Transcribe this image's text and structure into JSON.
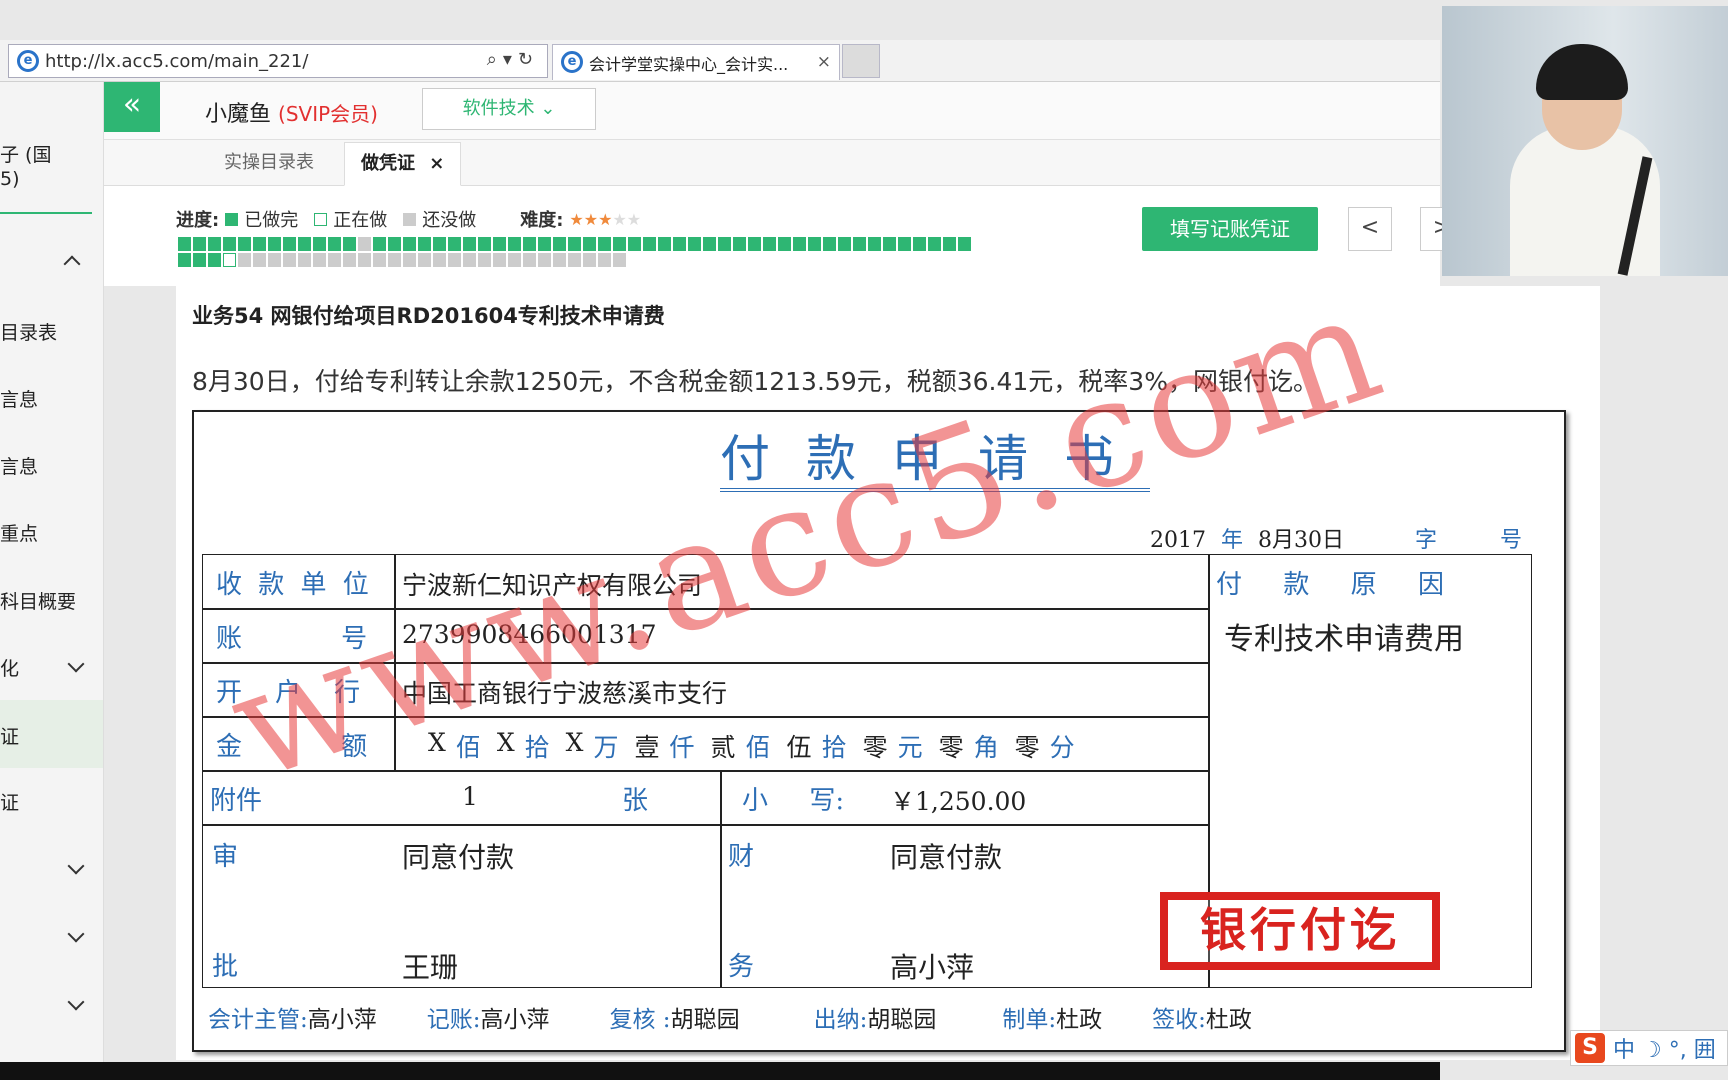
{
  "browser": {
    "url": "http://lx.acc5.com/main_221/",
    "tab_title": "会计学堂实操中心_会计实...",
    "tab_close": "×"
  },
  "sidebar": {
    "top_label_1": "子 (国",
    "top_label_2": "5)",
    "items": [
      "目录表",
      "言息",
      "言息",
      "重点",
      "科目概要",
      "化",
      "证",
      "证"
    ]
  },
  "header": {
    "collapse_icon": "«",
    "username": "小魔鱼",
    "vip_badge": "(SVIP会员)",
    "soft_button": "软件技术 ⌄"
  },
  "tabs": [
    {
      "label": "实操目录表"
    },
    {
      "label": "做凭证",
      "close": "×"
    }
  ],
  "progress": {
    "label": "进度:",
    "done": "已做完",
    "doing": "正在做",
    "todo": "还没做",
    "difficulty_label": "难度:",
    "difficulty_stars": 3,
    "difficulty_max": 5,
    "row1_done": 53,
    "row2": {
      "done": 3,
      "doing_index": 3,
      "total": 30
    }
  },
  "actions": {
    "fill_voucher": "填写记账凭证",
    "prev": "<",
    "next": ">"
  },
  "business": {
    "title": "业务54 网银付给项目RD201604专利技术申请费",
    "description": "8月30日，付给专利转让余款1250元，不含税金额1213.59元，税额36.41元，税率3%，网银付讫。"
  },
  "form": {
    "title": "付款申请书",
    "date_year": "2017",
    "date_year_unit": "年",
    "date_md": "8月30日",
    "zi": "字",
    "hao": "号",
    "payee_label": "收 款 单 位",
    "payee": "宁波新仁知识产权有限公司",
    "account_label": "账            号",
    "account": "2739908466001317",
    "bank_label": "开    户    行",
    "bank": "中国工商银行宁波慈溪市支行",
    "amount_label": "金            额",
    "amount_capital": [
      [
        "X",
        "佰"
      ],
      [
        "X",
        "拾"
      ],
      [
        "X",
        "万"
      ],
      [
        "壹",
        "仟"
      ],
      [
        "贰",
        "佰"
      ],
      [
        "伍",
        "拾"
      ],
      [
        "零",
        "元"
      ],
      [
        "零",
        "角"
      ],
      [
        "零",
        "分"
      ]
    ],
    "attach_label": "附件",
    "attach_count": "1",
    "attach_unit": "张",
    "small_label": "小     写:",
    "small_amount": "￥1,250.00",
    "reason_label": "付     款     原     因",
    "reason": "专利技术申请费用",
    "approve_label_1": "审",
    "approve_label_2": "批",
    "approve_opinion": "同意付款",
    "approver": "王珊",
    "finance_label_1": "财",
    "finance_label_2": "务",
    "finance_opinion": "同意付款",
    "finance_person": "高小萍",
    "stamp": "银行付讫",
    "watermark": "www.acc5.com"
  },
  "signatures": [
    {
      "label": "会计主管:",
      "name": "高小萍"
    },
    {
      "label": "记账:",
      "name": "高小萍"
    },
    {
      "label": "复核 :",
      "name": "胡聪园"
    },
    {
      "label": "出纳:",
      "name": "胡聪园"
    },
    {
      "label": "制单:",
      "name": "杜政"
    },
    {
      "label": "签收:",
      "name": "杜政"
    }
  ],
  "ime": {
    "logo": "S",
    "text": "中 ☽ °, 囲"
  },
  "colors": {
    "accent": "#2eb673",
    "form_blue": "#2d6eb5",
    "stamp_red": "#d9231f",
    "vip_red": "#e23030"
  }
}
